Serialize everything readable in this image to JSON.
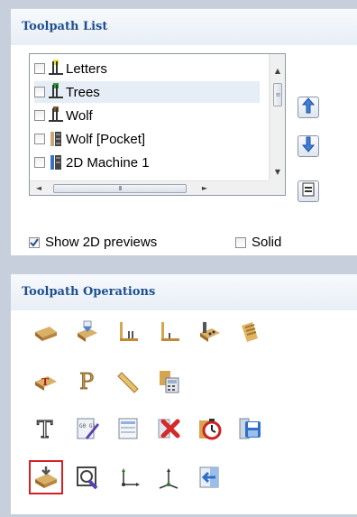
{
  "toolpath_list": {
    "title": "Toolpath List",
    "items": [
      {
        "label": "Letters",
        "icon": "toolpath-yellow-icon"
      },
      {
        "label": "Trees",
        "icon": "toolpath-green-icon"
      },
      {
        "label": "Wolf",
        "icon": "toolpath-brown-icon"
      },
      {
        "label": "Wolf [Pocket]",
        "icon": "pocket-toolpath-icon"
      },
      {
        "label": "2D Machine 1",
        "icon": "machine-toolpath-icon"
      }
    ],
    "selected": "Trees",
    "scroll_arrows": {
      "up": "▲",
      "down": "▼",
      "left": "◄",
      "right": "►",
      "grip_v": "≡",
      "grip_h": "III"
    },
    "side_buttons": [
      "move-up-icon",
      "move-down-icon",
      "tree-view-icon"
    ],
    "show_2d_previews": {
      "label": "Show 2D previews",
      "checked": true
    },
    "solid": {
      "label": "Solid",
      "checked": false
    }
  },
  "toolpath_operations": {
    "title": "Toolpath Operations",
    "icon_rows": [
      [
        "roughing-icon",
        "finishing-icon",
        "profile-icon",
        "pocket-icon",
        "drilling-icon",
        "texture-icon"
      ],
      [
        "fluting-icon",
        "vcarve-icon",
        "inlay-icon",
        "calculator-icon"
      ],
      [
        "engraving-text-icon",
        "gcode-edit-icon",
        "gcode-template-icon",
        "delete-toolpath-icon",
        "time-estimate-icon",
        "save-toolpath-icon"
      ],
      [
        "material-setup-icon",
        "preview-icon",
        "origin-xy-icon",
        "axis-rotate-icon",
        "import-toolpath-icon"
      ]
    ],
    "highlighted": "material-setup-icon",
    "badges": {
      "gcode": "G0 G1",
      "time": "O"
    },
    "letters": {
      "text_t": "T",
      "vcarve_p": "P",
      "fluting_t": "T"
    }
  },
  "colors": {
    "accent": "#1d4f8e",
    "highlight": "#d71f26",
    "background": "#c6cfdb"
  }
}
